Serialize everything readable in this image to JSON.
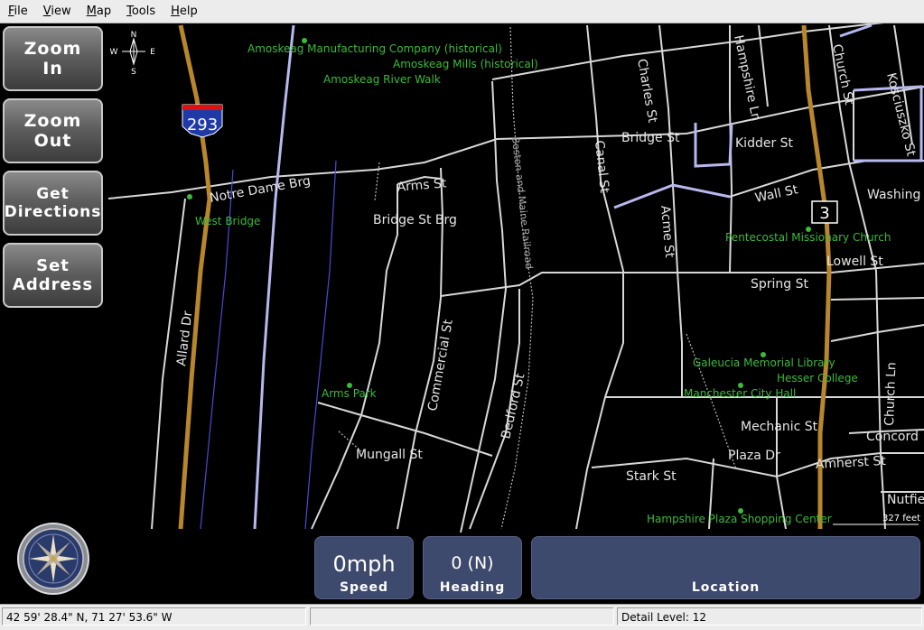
{
  "menu": [
    "File",
    "View",
    "Map",
    "Tools",
    "Help"
  ],
  "buttons": {
    "zoom_in": [
      "Zoom",
      "In"
    ],
    "zoom_out": [
      "Zoom",
      "Out"
    ],
    "get_directions": [
      "Get",
      "Directions"
    ],
    "set_address": [
      "Set",
      "Address"
    ]
  },
  "compass_rose": {
    "n": "N",
    "s": "S",
    "e": "E",
    "w": "W"
  },
  "shields": {
    "interstate": "293",
    "route": "3"
  },
  "streets": [
    "Notre Dame Brg",
    "Arms St",
    "Bridge St Brg",
    "Bridge St",
    "Kidder St",
    "Charles St",
    "Hampshire Ln",
    "Church St",
    "Kosciuszko St",
    "Canal St",
    "Acme St",
    "Wall St",
    "Washing",
    "Lowell St",
    "Spring St",
    "Allard Dr",
    "Commercial St",
    "Bedford St",
    "Boston and Maine Railroad",
    "Mungall St",
    "Mechanic St",
    "Plaza Dr",
    "Stark St",
    "Amherst St",
    "Church Ln",
    "Concord",
    "Nutfie"
  ],
  "places": [
    "Amoskeag Manufacturing Company (historical)",
    "Amoskeag Mills (historical)",
    "Amoskeag River Walk",
    "West Bridge",
    "Pentecostal Missionary Church",
    "Arms Park",
    "Galeucia Memorial Library",
    "Hesser College",
    "Manchester City Hall",
    "Hampshire Plaza Shopping Center"
  ],
  "scale": "327 feet",
  "speed": {
    "value": "0mph",
    "label": "Speed"
  },
  "heading": {
    "value": "0 (N)",
    "label": "Heading"
  },
  "location": {
    "value": "",
    "label": "Location"
  },
  "status": {
    "coords": "42 59' 28.4\" N, 71 27' 53.6\" W",
    "middle": "",
    "detail": "Detail Level: 12"
  },
  "colors": {
    "road": "#d8d8d8",
    "highway": "#b8862b",
    "river": "#b8b8f0",
    "poi": "#3cba3c",
    "panel": "#3e4a6d"
  }
}
